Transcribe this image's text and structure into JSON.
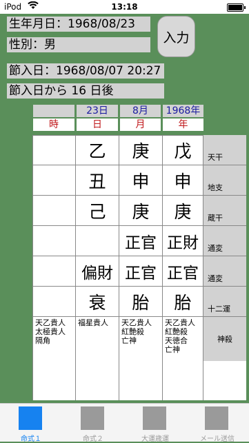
{
  "status": {
    "carrier": "iPod",
    "time": "13:18"
  },
  "birth_date": "生年月日：1968/08/23",
  "gender": "性別：男",
  "input_button": "入力",
  "setsu_date": "節入日：1968/08/07 20:27",
  "days_after": "節入日から 16 日後",
  "columns": {
    "headers": [
      "",
      "23日",
      "8月",
      "1968年"
    ],
    "labels": [
      "時",
      "日",
      "月",
      "年"
    ]
  },
  "rows": [
    {
      "cells": [
        "",
        "乙",
        "庚",
        "戊"
      ],
      "label": "天干"
    },
    {
      "cells": [
        "",
        "丑",
        "申",
        "申"
      ],
      "label": "地支"
    },
    {
      "cells": [
        "",
        "己",
        "庚",
        "庚"
      ],
      "label": "蔵干"
    },
    {
      "cells": [
        "",
        "",
        "正官",
        "正財"
      ],
      "label": "通変"
    },
    {
      "cells": [
        "",
        "偏財",
        "正官",
        "正官"
      ],
      "label": "通変"
    },
    {
      "cells": [
        "",
        "衰",
        "胎",
        "胎"
      ],
      "label": "十二運"
    }
  ],
  "gods": {
    "cols": [
      [
        "天乙貴人",
        "太極貴人",
        "隔角"
      ],
      [
        "福星貴人"
      ],
      [
        "天乙貴人",
        "紅艶殺",
        "亡神"
      ],
      [
        "天乙貴人",
        "紅艶殺",
        "天徳合",
        "亡神"
      ]
    ],
    "label": "神殺"
  },
  "tabs": [
    {
      "label": "命式１"
    },
    {
      "label": "命式２"
    },
    {
      "label": "大運歳運"
    },
    {
      "label": "メール送信"
    }
  ],
  "colors": {
    "background": "#5a8f5a",
    "accent": "#1682f0",
    "header_blue": "#1a1aa0",
    "header_red": "#c0171a"
  }
}
